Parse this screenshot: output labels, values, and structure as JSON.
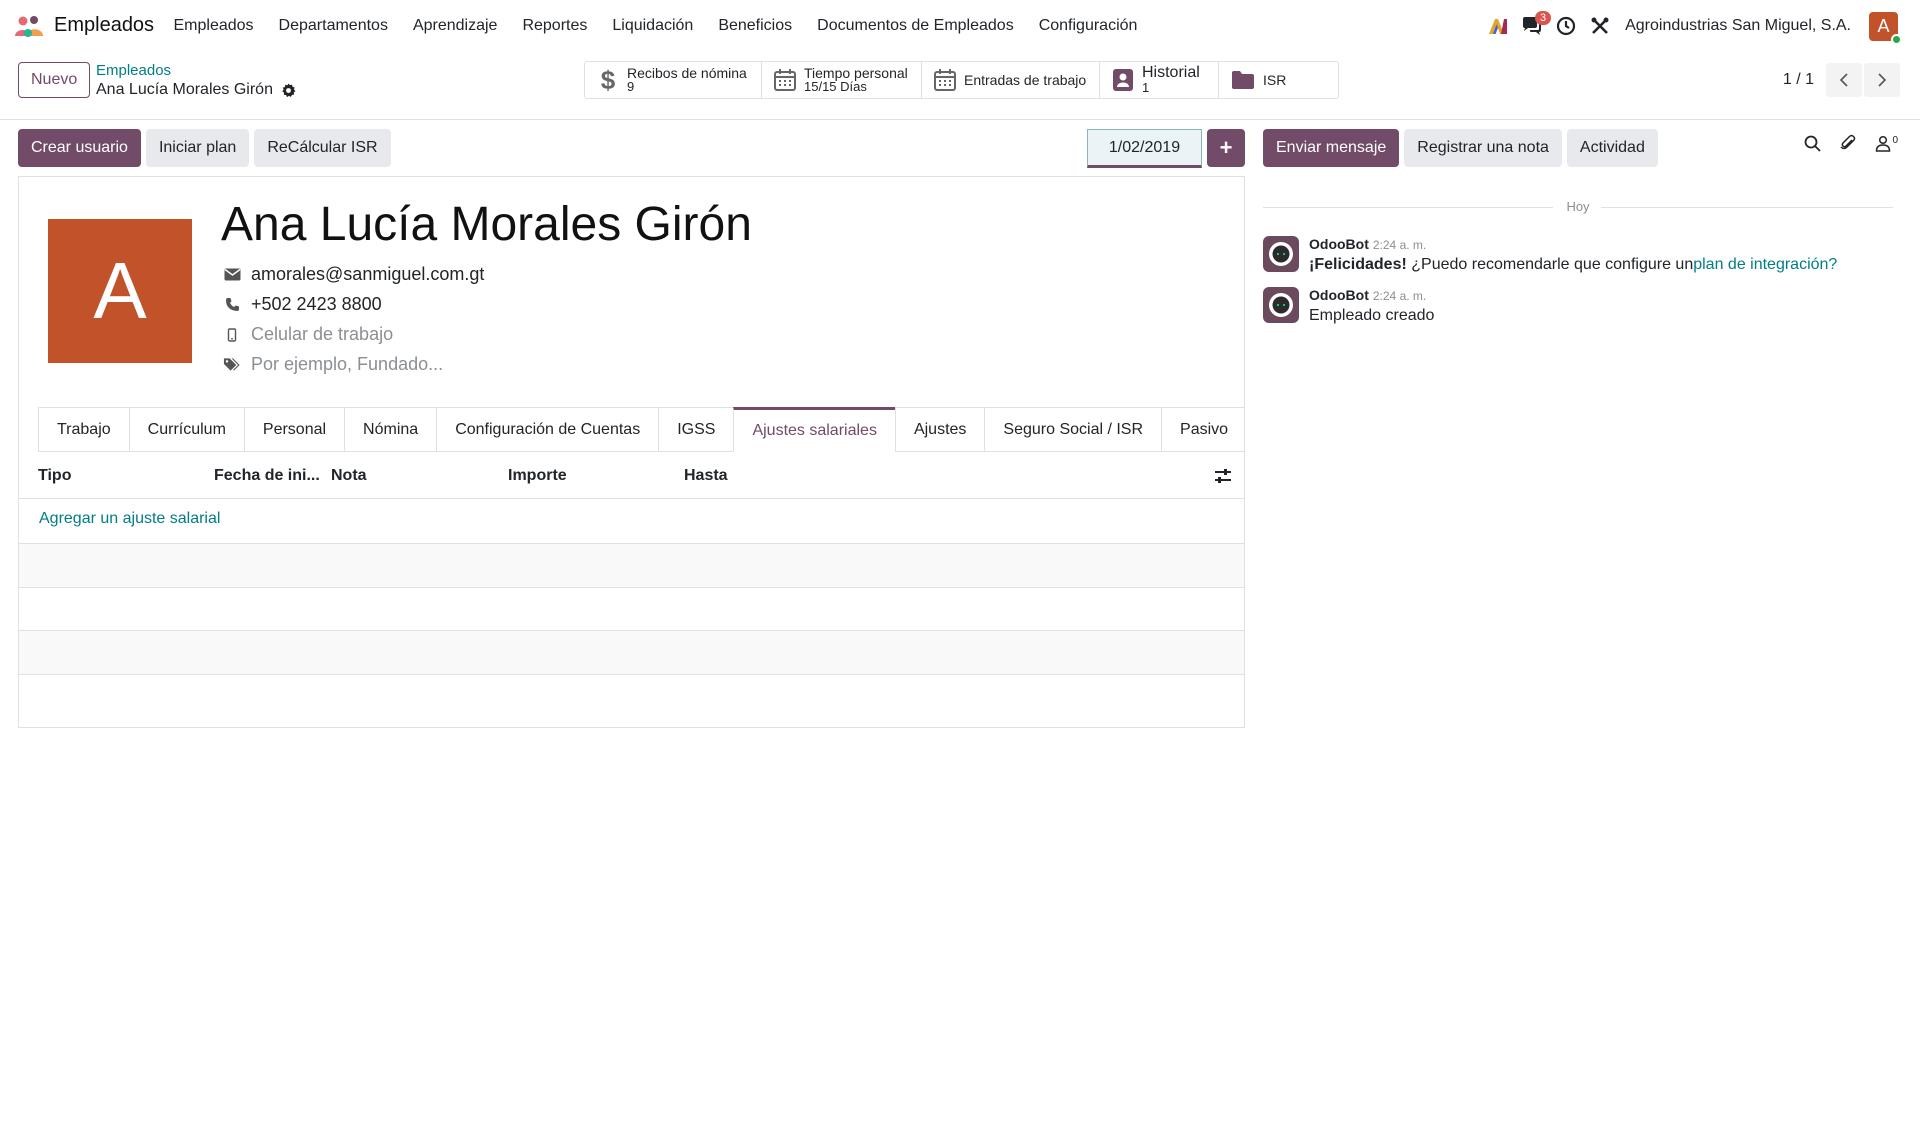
{
  "navbar": {
    "app_name": "Empleados",
    "menu": [
      "Empleados",
      "Departamentos",
      "Aprendizaje",
      "Reportes",
      "Liquidación",
      "Beneficios",
      "Documentos de Empleados",
      "Configuración"
    ],
    "messages_count": "3",
    "company": "Agroindustrias San Miguel, S.A.",
    "user_initial": "A"
  },
  "control": {
    "new_label": "Nuevo",
    "breadcrumb_parent": "Empleados",
    "breadcrumb_current": "Ana Lucía Morales Girón",
    "smart_buttons": [
      {
        "title": "Recibos de nómina",
        "value": "9"
      },
      {
        "title": "Tiempo personal",
        "value": "15/15 Días"
      },
      {
        "title": "Entradas de trabajo",
        "value": ""
      },
      {
        "title": "Historial",
        "value": "1"
      },
      {
        "title": "ISR",
        "value": ""
      }
    ],
    "pager": "1 / 1"
  },
  "statusbar": {
    "create_user": "Crear usuario",
    "start_plan": "Iniciar plan",
    "recalc_isr": "ReCálcular ISR",
    "date": "1/02/2019",
    "plus": "+"
  },
  "employee": {
    "initial": "A",
    "name": "Ana Lucía Morales Girón",
    "email": "amorales@sanmiguel.com.gt",
    "phone": "+502 2423 8800",
    "mobile_placeholder": "Celular de trabajo",
    "tags_placeholder": "Por ejemplo, Fundado..."
  },
  "tabs": [
    "Trabajo",
    "Currículum",
    "Personal",
    "Nómina",
    "Configuración de Cuentas",
    "IGSS",
    "Ajustes salariales",
    "Ajustes",
    "Seguro Social / ISR",
    "Pasivo"
  ],
  "table": {
    "columns": [
      "Tipo",
      "Fecha de ini...",
      "Nota",
      "Importe",
      "Hasta"
    ],
    "add_line": "Agregar un ajuste salarial"
  },
  "chatter": {
    "send_message": "Enviar mensaje",
    "log_note": "Registrar una nota",
    "activity": "Actividad",
    "followers_count": "0",
    "today": "Hoy",
    "messages": [
      {
        "author": "OdooBot",
        "time": "2:24 a. m.",
        "bold": "¡Felicidades!",
        "text": " ¿Puedo recomendarle que configure un",
        "link": "plan de integración?"
      },
      {
        "author": "OdooBot",
        "time": "2:24 a. m.",
        "text": "Empleado creado"
      }
    ]
  },
  "colors": {
    "brand": "#714b67",
    "link": "#017e84",
    "avatar": "#c2522a",
    "badge": "#d9534f"
  }
}
